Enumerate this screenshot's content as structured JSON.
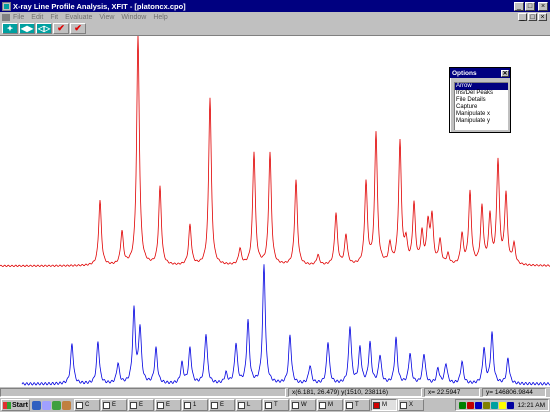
{
  "window": {
    "title": "X-ray Line Profile Analysis, XFIT - [platoncx.cpo]"
  },
  "menu": {
    "items": [
      "File",
      "Edit",
      "Fit",
      "Evaluate",
      "View",
      "Window",
      "Help"
    ]
  },
  "toolbar": {
    "buttons": [
      {
        "name": "add-peak-button",
        "glyph": "✦"
      },
      {
        "name": "zoom-button",
        "glyph": "◀▶"
      },
      {
        "name": "shift-button",
        "glyph": "◁▷"
      },
      {
        "name": "fit-check-button",
        "glyph": "✔"
      },
      {
        "name": "fit-check-red-button",
        "glyph": "✔"
      }
    ]
  },
  "options_palette": {
    "title": "Options",
    "close_glyph": "✕",
    "items": [
      "Arrow",
      "Ins/Del Peaks",
      "File Details",
      "Capture",
      "Manipulate x",
      "Manipulate y"
    ],
    "selected": "Arrow"
  },
  "status": {
    "position": "x(6.181, 26.479) y(1510, 238116)",
    "x_value": "x= 22.5947",
    "y_value": "y= 146806.9844"
  },
  "taskbar": {
    "start_label": "Start",
    "tasks": [
      {
        "label": "C",
        "active": false
      },
      {
        "label": "E",
        "active": false
      },
      {
        "label": "E",
        "active": false
      },
      {
        "label": "E",
        "active": false
      },
      {
        "label": "1",
        "active": false
      },
      {
        "label": "E",
        "active": false
      },
      {
        "label": "L",
        "active": false
      },
      {
        "label": "T",
        "active": false
      },
      {
        "label": "W",
        "active": false
      },
      {
        "label": "M",
        "active": false
      },
      {
        "label": "T",
        "active": false
      },
      {
        "label": "M",
        "active": true
      },
      {
        "label": "X",
        "active": false
      }
    ],
    "clock": "12:21 AM"
  },
  "chart_data": {
    "type": "line",
    "title": "",
    "xlabel": "",
    "ylabel": "",
    "x": [
      0,
      40,
      60,
      76,
      92,
      100,
      110,
      122,
      138,
      160,
      190,
      210,
      240,
      254,
      270,
      296,
      318,
      336,
      346,
      366,
      376,
      390,
      400,
      406,
      414,
      422,
      428,
      432,
      440,
      448,
      462,
      470,
      482,
      490,
      498,
      506,
      514,
      550
    ],
    "series": [
      {
        "color": "#e00000",
        "peaks": [
          {
            "x": 100,
            "h": 65
          },
          {
            "x": 122,
            "h": 33
          },
          {
            "x": 138,
            "h": 230
          },
          {
            "x": 160,
            "h": 78
          },
          {
            "x": 190,
            "h": 40
          },
          {
            "x": 210,
            "h": 168
          },
          {
            "x": 240,
            "h": 16
          },
          {
            "x": 254,
            "h": 113
          },
          {
            "x": 270,
            "h": 112
          },
          {
            "x": 296,
            "h": 85
          },
          {
            "x": 318,
            "h": 10
          },
          {
            "x": 336,
            "h": 52
          },
          {
            "x": 346,
            "h": 30
          },
          {
            "x": 366,
            "h": 82
          },
          {
            "x": 376,
            "h": 132
          },
          {
            "x": 390,
            "h": 20
          },
          {
            "x": 400,
            "h": 122
          },
          {
            "x": 406,
            "h": 22
          },
          {
            "x": 414,
            "h": 60
          },
          {
            "x": 422,
            "h": 30
          },
          {
            "x": 428,
            "h": 40
          },
          {
            "x": 432,
            "h": 47
          },
          {
            "x": 440,
            "h": 24
          },
          {
            "x": 448,
            "h": 10
          },
          {
            "x": 462,
            "h": 30
          },
          {
            "x": 470,
            "h": 72
          },
          {
            "x": 482,
            "h": 57
          },
          {
            "x": 490,
            "h": 48
          },
          {
            "x": 498,
            "h": 103
          },
          {
            "x": 506,
            "h": 70
          },
          {
            "x": 514,
            "h": 20
          }
        ]
      },
      {
        "color": "#0000e0",
        "peaks": [
          {
            "x": 72,
            "h": 40
          },
          {
            "x": 98,
            "h": 42
          },
          {
            "x": 118,
            "h": 20
          },
          {
            "x": 134,
            "h": 73
          },
          {
            "x": 140,
            "h": 55
          },
          {
            "x": 156,
            "h": 35
          },
          {
            "x": 182,
            "h": 20
          },
          {
            "x": 190,
            "h": 35
          },
          {
            "x": 206,
            "h": 50
          },
          {
            "x": 226,
            "h": 10
          },
          {
            "x": 236,
            "h": 40
          },
          {
            "x": 248,
            "h": 62
          },
          {
            "x": 264,
            "h": 118
          },
          {
            "x": 290,
            "h": 48
          },
          {
            "x": 310,
            "h": 18
          },
          {
            "x": 328,
            "h": 42
          },
          {
            "x": 350,
            "h": 57
          },
          {
            "x": 360,
            "h": 35
          },
          {
            "x": 370,
            "h": 40
          },
          {
            "x": 380,
            "h": 28
          },
          {
            "x": 396,
            "h": 45
          },
          {
            "x": 410,
            "h": 30
          },
          {
            "x": 424,
            "h": 30
          },
          {
            "x": 438,
            "h": 15
          },
          {
            "x": 446,
            "h": 20
          },
          {
            "x": 462,
            "h": 22
          },
          {
            "x": 484,
            "h": 35
          },
          {
            "x": 492,
            "h": 50
          },
          {
            "x": 508,
            "h": 25
          }
        ]
      }
    ],
    "grid": false,
    "legend": "none"
  }
}
